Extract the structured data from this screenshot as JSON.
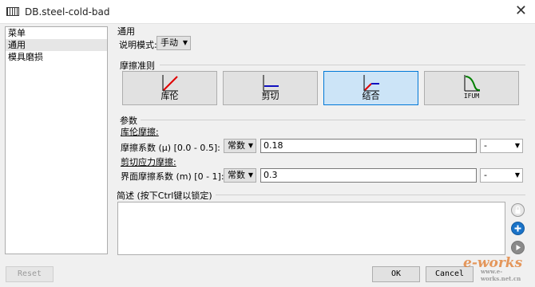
{
  "window": {
    "title": "DB.steel-cold-bad"
  },
  "sidebar": {
    "items": [
      {
        "label": "菜单",
        "selected": false
      },
      {
        "label": "通用",
        "selected": true
      },
      {
        "label": "模具磨损",
        "selected": false
      }
    ]
  },
  "general": {
    "group_label": "通用",
    "mode_label": "说明模式:",
    "mode_value": "手动"
  },
  "friction_law": {
    "group_label": "摩擦准则",
    "buttons": [
      {
        "label": "库伦",
        "selected": false
      },
      {
        "label": "剪切",
        "selected": false
      },
      {
        "label": "结合",
        "selected": true
      },
      {
        "label": "IFUM",
        "selected": false
      }
    ]
  },
  "params": {
    "group_label": "参数",
    "coulomb": {
      "heading": "库伦摩擦:",
      "label": "摩擦系数 (μ) [0.0 - 0.5]:",
      "type": "常数",
      "value": "0.18",
      "unit": "-"
    },
    "shear": {
      "heading": "剪切应力摩擦:",
      "label": "界面摩擦系数 (m) [0 - 1]:",
      "type": "常数",
      "value": "0.3",
      "unit": "-"
    }
  },
  "notes": {
    "label": "简述 (按下Ctrl键以锁定)"
  },
  "footer": {
    "reset": "Reset",
    "ok": "OK",
    "cancel": "Cancel"
  },
  "watermark": {
    "text": "e-works",
    "sub": "www.e-works.net.cn"
  },
  "colors": {
    "accent": "#0078d7",
    "selected_bg": "#cce4f7",
    "curve_red": "#e00000",
    "curve_blue": "#1010c0",
    "curve_green": "#008000"
  }
}
